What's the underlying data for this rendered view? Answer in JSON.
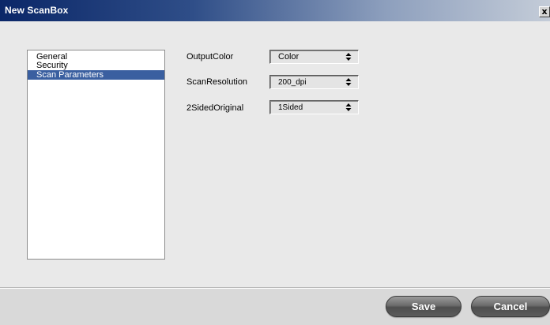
{
  "window": {
    "title": "New ScanBox",
    "close_label": "x"
  },
  "sidebar": {
    "items": [
      {
        "label": "General",
        "selected": false
      },
      {
        "label": "Security",
        "selected": false
      },
      {
        "label": "Scan Parameters",
        "selected": true
      }
    ]
  },
  "form": {
    "output_color": {
      "label": "OutputColor",
      "value": "Color"
    },
    "scan_resolution": {
      "label": "ScanResolution",
      "value": "200_dpi"
    },
    "two_sided_original": {
      "label": "2SidedOriginal",
      "value": "1Sided"
    }
  },
  "footer": {
    "save_label": "Save",
    "cancel_label": "Cancel"
  },
  "colors": {
    "titlebar_start": "#0b2768",
    "selection": "#3a5fa0",
    "dialog_bg": "#e9e9e9"
  },
  "icons": {
    "close": "close-icon",
    "select_arrow": "updown-arrow-icon"
  }
}
